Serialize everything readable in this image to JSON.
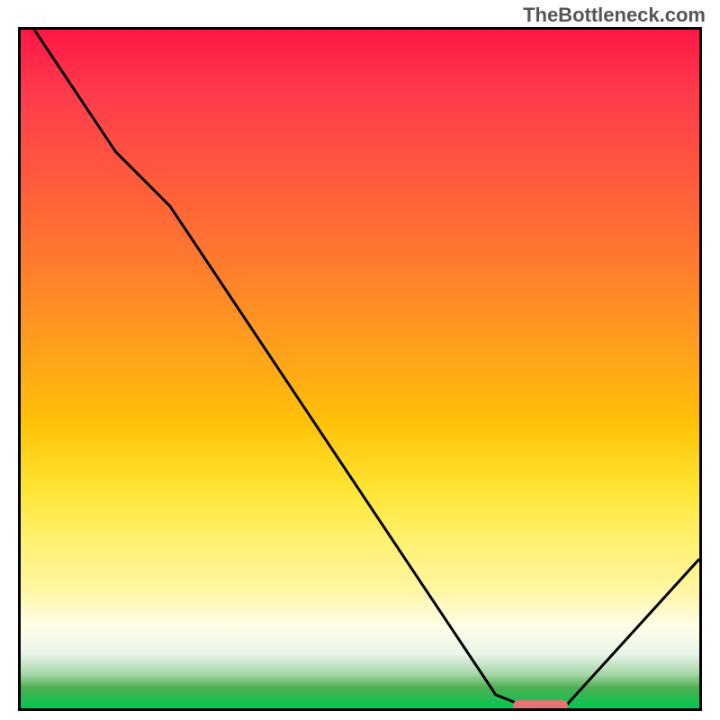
{
  "watermark": "TheBottleneck.com",
  "chart_data": {
    "type": "line",
    "title": "",
    "xlabel": "",
    "ylabel": "",
    "xlim": [
      0,
      100
    ],
    "ylim": [
      0,
      100
    ],
    "series": [
      {
        "name": "curve",
        "x": [
          2,
          14,
          22,
          70,
          75,
          80,
          100
        ],
        "y": [
          100,
          82,
          74,
          2,
          0,
          0,
          22
        ]
      }
    ],
    "marker": {
      "x_start": 72,
      "x_end": 80,
      "y": 1.2
    },
    "gradient_stops": [
      {
        "pos": 0,
        "color": "#ff1744"
      },
      {
        "pos": 50,
        "color": "#ffc107"
      },
      {
        "pos": 85,
        "color": "#fff59d"
      },
      {
        "pos": 100,
        "color": "#00c853"
      }
    ]
  },
  "colors": {
    "curve": "#000000",
    "marker": "#e57373",
    "border": "#000000"
  }
}
